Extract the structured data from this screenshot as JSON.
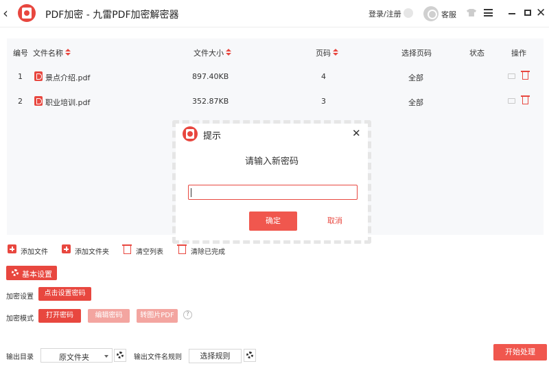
{
  "titlebar": {
    "title": "PDF加密 - 九雷PDF加密解密器",
    "login": "登录/注册",
    "service": "客服"
  },
  "table": {
    "headers": {
      "index": "编号",
      "filename": "文件名称",
      "filesize": "文件大小",
      "pages": "页码",
      "select_pages": "选择页码",
      "status": "状态",
      "actions": "操作"
    },
    "rows": [
      {
        "index": "1",
        "filename": "景点介绍.pdf",
        "filesize": "897.40KB",
        "pages": "4",
        "select_pages": "全部",
        "status": ""
      },
      {
        "index": "2",
        "filename": "职业培训.pdf",
        "filesize": "352.87KB",
        "pages": "3",
        "select_pages": "全部",
        "status": ""
      }
    ]
  },
  "toolbar": {
    "add_file": "添加文件",
    "add_folder": "添加文件夹",
    "clear_list": "清空列表",
    "clear_done": "清除已完成"
  },
  "settings": {
    "basic_settings": "基本设置",
    "encrypt_settings_label": "加密设置",
    "set_password_button": "点击设置密码",
    "encrypt_mode_label": "加密模式",
    "mode_open_password": "打开密码",
    "mode_edit_password": "编辑密码",
    "mode_to_image_pdf": "转图片PDF"
  },
  "bottom": {
    "output_dir_label": "输出目录",
    "output_dir_value": "原文件夹",
    "output_name_rule_label": "输出文件名规则",
    "choose_rule_button": "选择规则",
    "start_button": "开始处理"
  },
  "dialog": {
    "title": "提示",
    "prompt": "请输入新密码",
    "password_value": "",
    "ok_button": "确定",
    "cancel_button": "取消"
  },
  "colors": {
    "accent": "#e8473f",
    "accent_light": "#f3a5a0",
    "table_bg": "#f7f8fa"
  }
}
